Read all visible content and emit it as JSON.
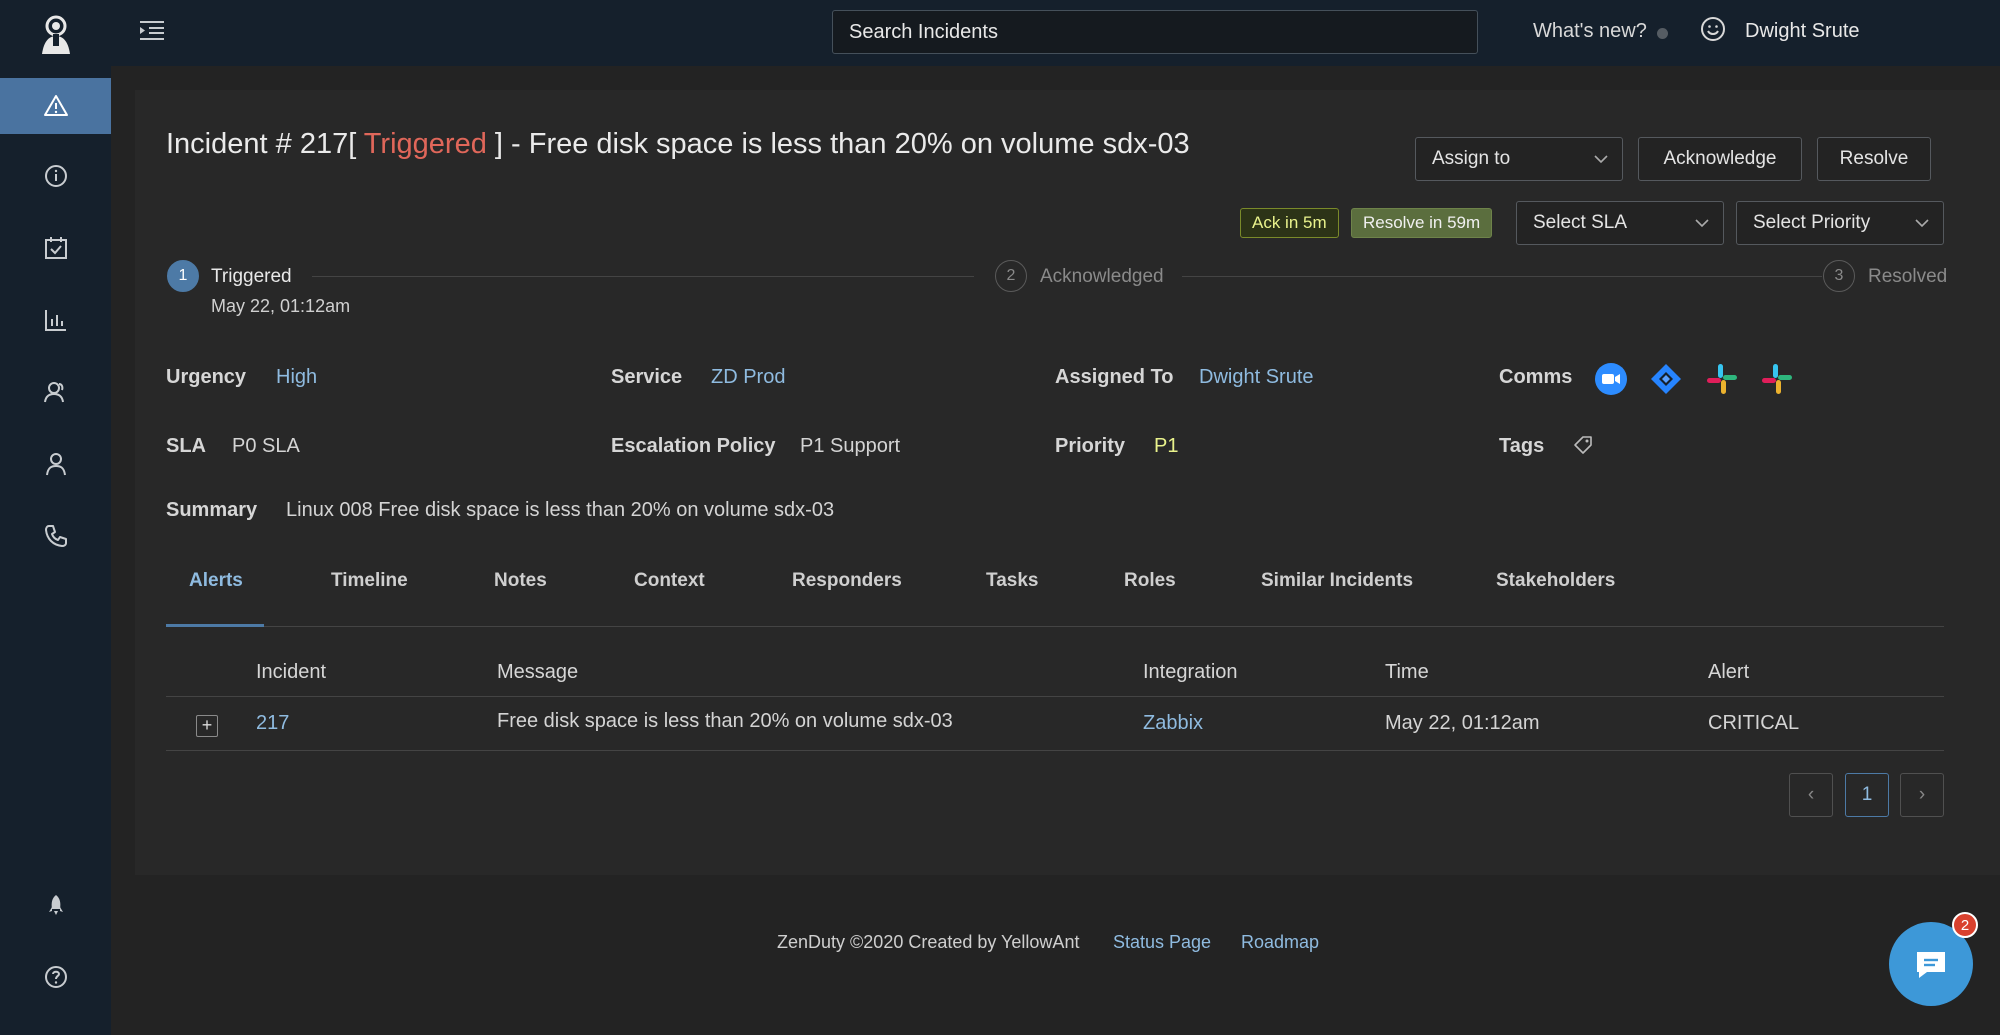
{
  "header": {
    "search_placeholder": "Search Incidents",
    "whats_new": "What's new?",
    "user_name": "Dwight Srute"
  },
  "incident": {
    "title_prefix": "Incident # 217[ ",
    "state": "Triggered",
    "title_suffix": " ] - Free disk space is less than 20% on volume sdx-03"
  },
  "actions": {
    "assign_to": "Assign to",
    "acknowledge": "Acknowledge",
    "resolve": "Resolve",
    "select_sla": "Select SLA",
    "select_priority": "Select Priority",
    "ack_timer": "Ack in 5m",
    "resolve_timer": "Resolve in 59m"
  },
  "stepper": [
    {
      "num": "1",
      "label": "Triggered",
      "sub": "May 22, 01:12am"
    },
    {
      "num": "2",
      "label": "Acknowledged"
    },
    {
      "num": "3",
      "label": "Resolved"
    }
  ],
  "fields": {
    "urgency_label": "Urgency",
    "urgency_value": "High",
    "service_label": "Service",
    "service_value": "ZD Prod",
    "assigned_label": "Assigned To",
    "assigned_value": "Dwight Srute",
    "comms_label": "Comms",
    "sla_label": "SLA",
    "sla_value": "P0 SLA",
    "escalation_label": "Escalation Policy",
    "escalation_value": "P1 Support",
    "priority_label": "Priority",
    "priority_value": "P1",
    "tags_label": "Tags",
    "summary_label": "Summary",
    "summary_value": "Linux 008 Free disk space is less than 20% on volume sdx-03"
  },
  "comms_icons": [
    "zoom-icon",
    "jira-icon",
    "slack-icon",
    "slack-icon"
  ],
  "tabs": [
    "Alerts",
    "Timeline",
    "Notes",
    "Context",
    "Responders",
    "Tasks",
    "Roles",
    "Similar Incidents",
    "Stakeholders"
  ],
  "table": {
    "columns": [
      "Incident",
      "Message",
      "Integration",
      "Time",
      "Alert"
    ],
    "rows": [
      {
        "incident": "217",
        "message": "Free disk space is less than 20% on volume sdx-03",
        "integration": "Zabbix",
        "time": "May 22, 01:12am",
        "alert": "CRITICAL",
        "expand": "+"
      }
    ]
  },
  "pagination": {
    "prev": "‹",
    "current": "1",
    "next": "›"
  },
  "footer": {
    "copyright": "ZenDuty ©2020 Created by YellowAnt",
    "status_page": "Status Page",
    "roadmap": "Roadmap"
  },
  "chat": {
    "badge": "2"
  },
  "colors": {
    "sidebar_bg": "#15202c",
    "active_nav": "#4a73a0",
    "accent": "#4d7aa6",
    "link": "#8fbbe0",
    "triggered": "#e0675a",
    "priority": "#e9f28c"
  }
}
